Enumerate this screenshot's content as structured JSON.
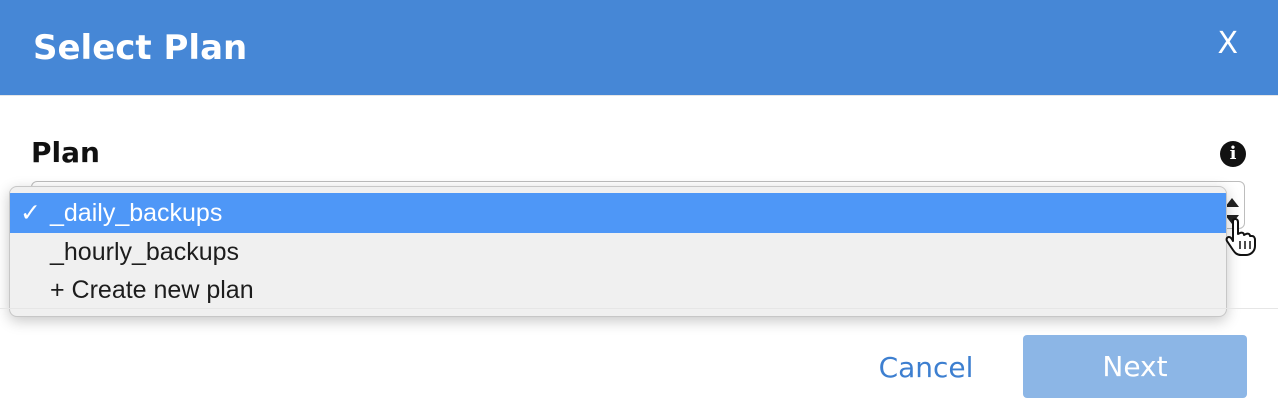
{
  "dialog": {
    "title": "Select Plan",
    "close_label": "X"
  },
  "form": {
    "plan_label": "Plan",
    "info_icon": "info-icon",
    "info_glyph": "i"
  },
  "dropdown": {
    "options": [
      {
        "label": "_daily_backups",
        "selected": true,
        "check": "✓"
      },
      {
        "label": "_hourly_backups",
        "selected": false
      },
      {
        "label": "+ Create new plan",
        "selected": false
      }
    ]
  },
  "footer": {
    "cancel_label": "Cancel",
    "next_label": "Next"
  },
  "colors": {
    "header_bg": "#4687d6",
    "selected_option_bg": "#4e97f7",
    "cancel_text": "#3d7fd0",
    "next_bg_disabled": "#8cb6e6"
  }
}
